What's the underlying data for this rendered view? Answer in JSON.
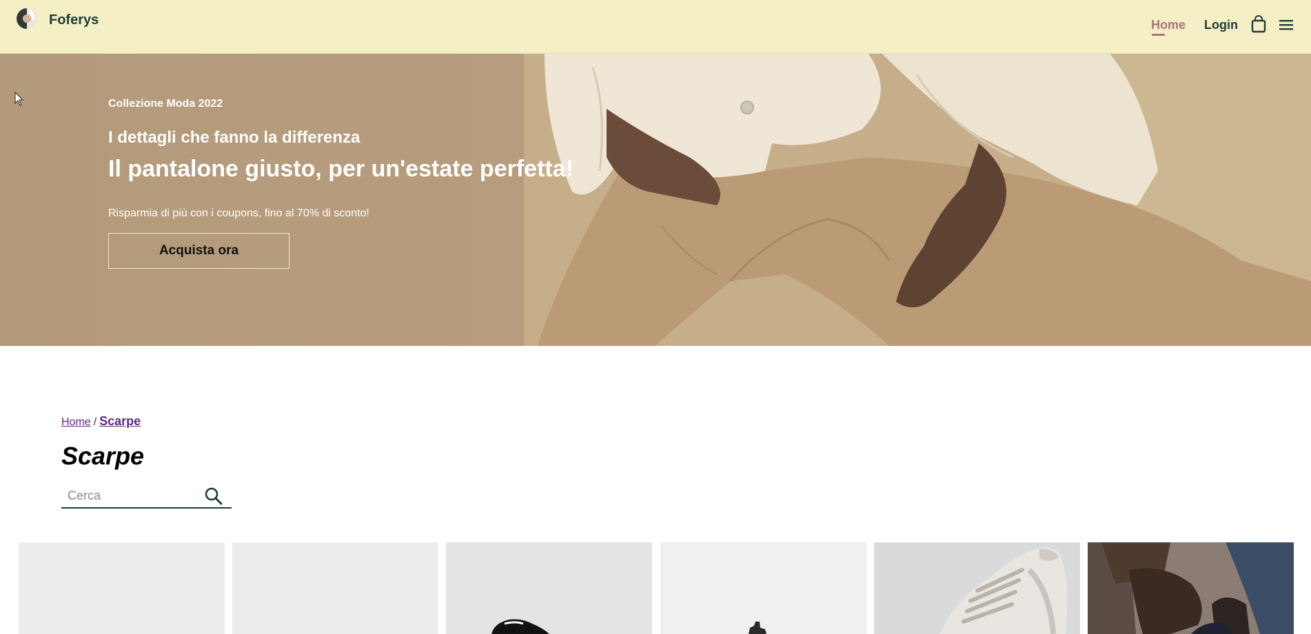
{
  "header": {
    "brand": "Foferys",
    "nav": {
      "home": "Home",
      "login": "Login"
    },
    "colors": {
      "background": "#f4efc5",
      "active": "#b2707a",
      "text": "#1d3d3a"
    }
  },
  "hero": {
    "eyebrow": "Collezione Moda 2022",
    "subtitle": "I dettagli che fanno la differenza",
    "title": "Il pantalone giusto, per un'estate perfetta!",
    "promo": "Risparmia di più con i coupons, fino al 70% di sconto!",
    "cta": "Acquista ora"
  },
  "breadcrumb": {
    "home": "Home",
    "separator": "/",
    "current": "Scarpe"
  },
  "page_title": "Scarpe",
  "search": {
    "placeholder": "Cerca",
    "value": ""
  },
  "product_tiles": [
    {
      "name": "product-tile-1",
      "image": "blank-light-gray"
    },
    {
      "name": "product-tile-2",
      "image": "blank-gray"
    },
    {
      "name": "product-tile-3",
      "image": "black-shoe"
    },
    {
      "name": "product-tile-4",
      "image": "boot-on-white"
    },
    {
      "name": "product-tile-5",
      "image": "white-sneaker"
    },
    {
      "name": "product-tile-6",
      "image": "person-tying-shoe"
    }
  ]
}
